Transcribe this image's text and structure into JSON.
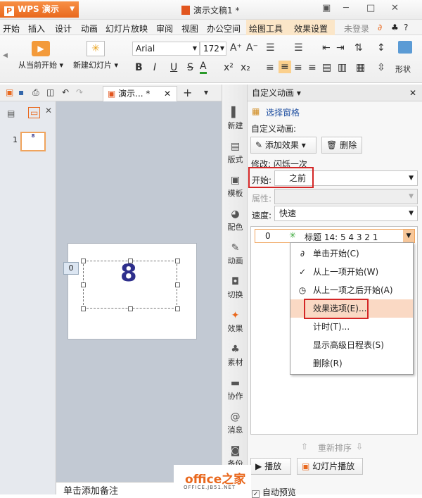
{
  "titlebar": {
    "app_button": "WPS 演示",
    "doc_title": "演示文稿1 *"
  },
  "menu": [
    "开始",
    "插入",
    "设计",
    "动画",
    "幻灯片放映",
    "审阅",
    "视图",
    "办公空间",
    "绘图工具",
    "效果设置",
    "未登录"
  ],
  "toolbar": {
    "play_from_current": "从当前开始",
    "new_slide": "新建幻灯片",
    "font": "Arial",
    "size": "172",
    "shape_label": "形状"
  },
  "quick": {
    "doc_tab": "演示... *"
  },
  "slides": {
    "number": "1",
    "slide_anim_tag": "0",
    "thumb_text": "8"
  },
  "notes": "单击添加备注",
  "sidebar": [
    "新建",
    "版式",
    "模板",
    "配色",
    "动画",
    "切换",
    "效果",
    "素材",
    "协作",
    "消息",
    "备份"
  ],
  "panel": {
    "title": "自定义动画",
    "select_pane": "选择窗格",
    "custom_anim_label": "自定义动画:",
    "add_effect": "添加效果",
    "delete": "删除",
    "modify": "修改: 闪烁一次",
    "start_label": "开始:",
    "start_value": "之前",
    "property_label": "属性:",
    "speed_label": "速度:",
    "speed_value": "快速",
    "list_item_num": "0",
    "list_item_text": "标题 14: 5 4 3 2 1",
    "reorder": "重新排序",
    "play": "播放",
    "slideshow": "幻灯片播放",
    "autopreview": "自动预览"
  },
  "context_menu": [
    "单击开始(C)",
    "从上一项开始(W)",
    "从上一项之后开始(A)",
    "效果选项(E)...",
    "计时(T)...",
    "显示高级日程表(S)",
    "删除(R)"
  ],
  "watermark": {
    "brand": "office之家",
    "url": "OFFICE.JB51.NET"
  },
  "colors": {
    "accent_orange": "#e9681d",
    "highlight_red": "#d42626",
    "menu_highlight": "#fad9c4"
  }
}
